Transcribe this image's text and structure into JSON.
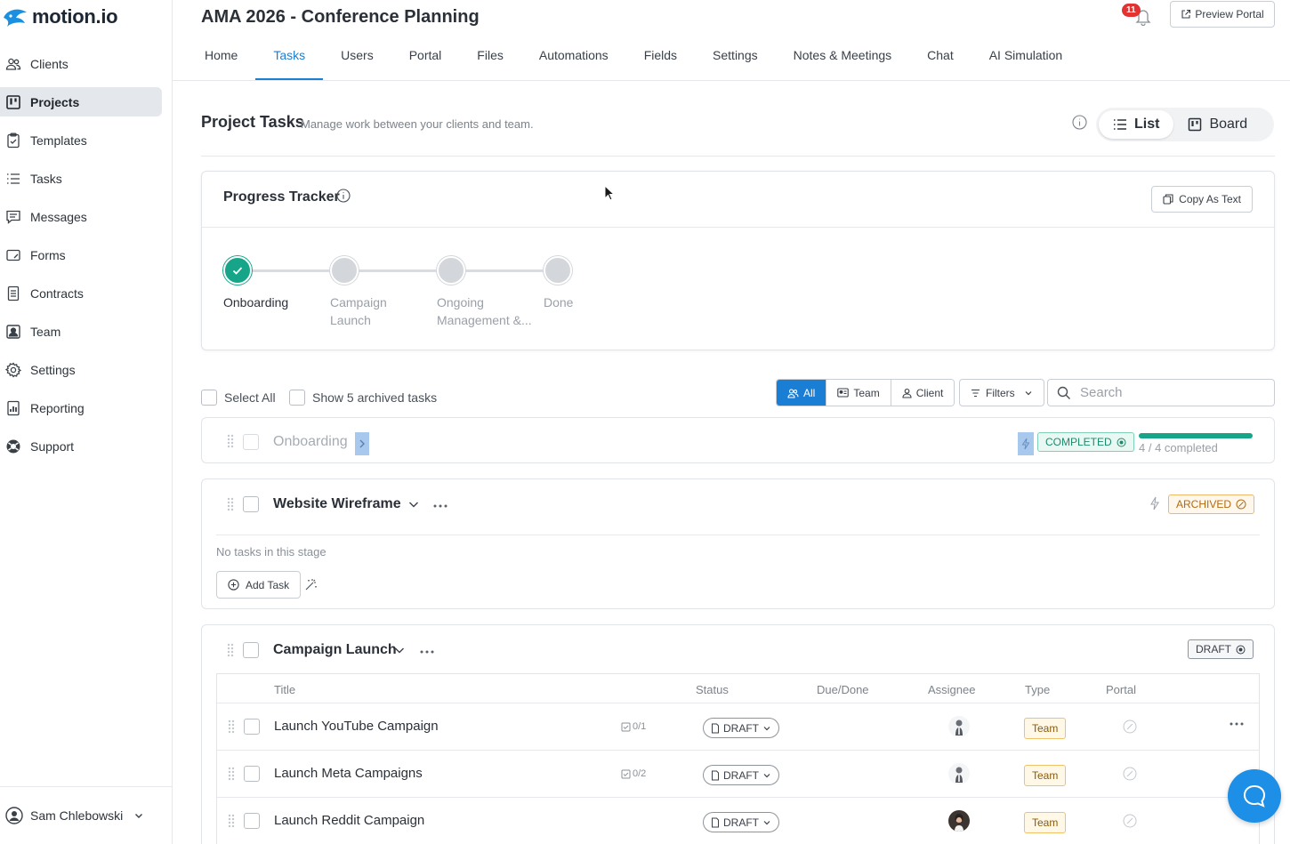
{
  "app": {
    "logo_text": "motion.io"
  },
  "sidebar": {
    "items": [
      {
        "label": "Clients",
        "icon": "users-icon"
      },
      {
        "label": "Projects",
        "icon": "board-icon",
        "active": true
      },
      {
        "label": "Templates",
        "icon": "clipboard-check-icon"
      },
      {
        "label": "Tasks",
        "icon": "list-icon"
      },
      {
        "label": "Messages",
        "icon": "message-icon"
      },
      {
        "label": "Forms",
        "icon": "form-icon"
      },
      {
        "label": "Contracts",
        "icon": "document-icon"
      },
      {
        "label": "Team",
        "icon": "team-icon"
      },
      {
        "label": "Settings",
        "icon": "gear-icon"
      },
      {
        "label": "Reporting",
        "icon": "reporting-icon"
      },
      {
        "label": "Support",
        "icon": "lifebuoy-icon"
      }
    ],
    "user": {
      "name": "Sam Chlebowski"
    }
  },
  "header": {
    "title": "AMA 2026 - Conference Planning",
    "notifications_count": "11",
    "preview_label": "Preview Portal",
    "tabs": [
      {
        "label": "Home"
      },
      {
        "label": "Tasks",
        "active": true
      },
      {
        "label": "Users"
      },
      {
        "label": "Portal"
      },
      {
        "label": "Files"
      },
      {
        "label": "Automations"
      },
      {
        "label": "Fields"
      },
      {
        "label": "Settings"
      },
      {
        "label": "Notes & Meetings"
      },
      {
        "label": "Chat"
      },
      {
        "label": "AI Simulation"
      }
    ]
  },
  "section": {
    "title": "Project Tasks",
    "subtitle": "Manage work between your clients and team.",
    "view_list": "List",
    "view_board": "Board"
  },
  "tracker": {
    "title": "Progress Tracker",
    "copy_label": "Copy As Text",
    "steps": [
      {
        "label": "Onboarding",
        "done": true
      },
      {
        "label": "Campaign Launch",
        "done": false
      },
      {
        "label": "Ongoing Management &...",
        "done": false
      },
      {
        "label": "Done",
        "done": false
      }
    ]
  },
  "toolbar": {
    "select_all": "Select All",
    "show_archived": "Show 5 archived tasks",
    "seg_all": "All",
    "seg_team": "Team",
    "seg_client": "Client",
    "filters": "Filters",
    "search_placeholder": "Search"
  },
  "stages": {
    "onboarding": {
      "name": "Onboarding",
      "status": "COMPLETED",
      "progress_text": "4 / 4 completed",
      "progress": 1.0
    },
    "wireframe": {
      "name": "Website Wireframe",
      "status": "ARCHIVED",
      "empty_text": "No tasks in this stage",
      "add_task": "Add Task"
    },
    "campaign": {
      "name": "Campaign Launch",
      "status": "DRAFT",
      "columns": [
        "Title",
        "Status",
        "Due/Done",
        "Assignee",
        "Type",
        "Portal"
      ],
      "tasks": [
        {
          "title": "Launch YouTube Campaign",
          "subtasks": "0/1",
          "status": "DRAFT",
          "type": "Team"
        },
        {
          "title": "Launch Meta Campaigns",
          "subtasks": "0/2",
          "status": "DRAFT",
          "type": "Team"
        },
        {
          "title": "Launch Reddit Campaign",
          "subtasks": "",
          "status": "DRAFT",
          "type": "Team"
        }
      ]
    }
  },
  "colors": {
    "accent": "#1a80d4",
    "success": "#17a589",
    "warning": "#f0b969"
  }
}
